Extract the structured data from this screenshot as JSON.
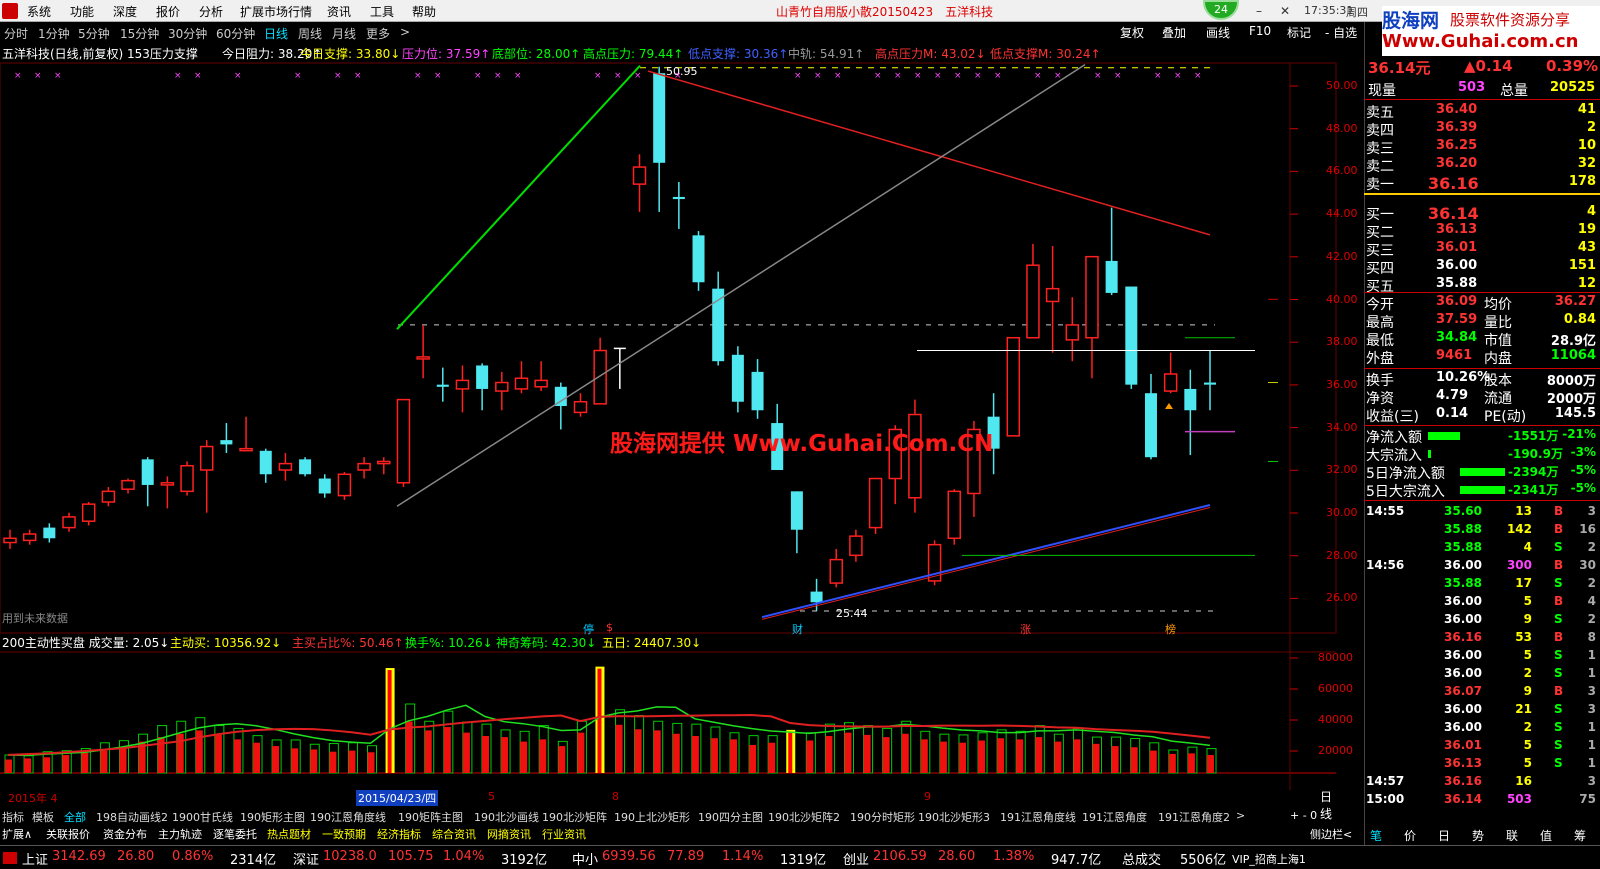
{
  "menu": {
    "items": [
      "系统",
      "功能",
      "深度",
      "报价",
      "分析",
      "扩展市场行情",
      "资讯",
      "工具",
      "帮助"
    ],
    "window_title": "山青竹自用版小散20150423　五洋科技",
    "badge": "24",
    "time": "17:35:31",
    "weekday": "周四"
  },
  "ad": {
    "line1": "股海网",
    "line2": "股票软件资源分享",
    "line3": "Www.Guhai.com.cn"
  },
  "periods": [
    "分时",
    "1分钟",
    "5分钟",
    "15分钟",
    "30分钟",
    "60分钟",
    "日线",
    "周线",
    "月线",
    "更多",
    ">"
  ],
  "active_period": "日线",
  "right_tools": [
    "复权",
    "叠加",
    "画线",
    "F10",
    "标记",
    "- 自选"
  ],
  "indicator_line": [
    {
      "text": "五洋科技(日线,前复权) 153压力支撑",
      "color": "#ffffff"
    },
    {
      "text": "今日阻力: 38.20↑",
      "color": "#ffffff"
    },
    {
      "text": "今日支撑: 33.80↓",
      "color": "#ffff00"
    },
    {
      "text": "压力位: 37.59↑",
      "color": "#ff44ff"
    },
    {
      "text": "底部位: 28.00↑",
      "color": "#00ff00"
    },
    {
      "text": "高点压力: 79.44↑",
      "color": "#00ff00"
    },
    {
      "text": "低点支撑: 30.36↑",
      "color": "#4060ff"
    },
    {
      "text": "中轨: 54.91↑",
      "color": "#999999"
    },
    {
      "text": "高点压力M: 43.02↓",
      "color": "#ff3333"
    },
    {
      "text": "低点支撑M: 30.24↑",
      "color": "#ff3333"
    }
  ],
  "price_axis": [
    "50.00",
    "48.00",
    "46.00",
    "44.00",
    "42.00",
    "40.00",
    "38.00",
    "36.00",
    "34.00",
    "32.00",
    "30.00",
    "28.00",
    "26.00"
  ],
  "volume_axis": [
    "80000",
    "60000",
    "40000",
    "20000"
  ],
  "annotations": {
    "high_label": "50.95",
    "low_label": "25.44",
    "future_note": "用到未来数据",
    "watermark": "股海网提供 Www.Guhai.Com.CN"
  },
  "markers": [
    {
      "text": "停",
      "color": "#00ccff"
    },
    {
      "text": "$",
      "color": "#ff3333"
    },
    {
      "text": "财",
      "color": "#00ccff"
    },
    {
      "text": "涨",
      "color": "#ff3333"
    },
    {
      "text": "榜",
      "color": "#ff9900"
    }
  ],
  "volume_line": [
    {
      "text": "200主动性买盘 成交量: 2.05↓",
      "color": "#ffffff"
    },
    {
      "text": "主动买: 10356.92↓",
      "color": "#ffff00"
    },
    {
      "text": "主买占比%: 50.46↑",
      "color": "#ff3333"
    },
    {
      "text": "换手%: 10.26↓",
      "color": "#00ff00"
    },
    {
      "text": "神奇筹码: 42.30↓",
      "color": "#00ff00"
    },
    {
      "text": "五日: 24407.30↓",
      "color": "#ffff00"
    }
  ],
  "date_axis": {
    "year": "2015年 4",
    "selected": "2015/04/23/四",
    "labels": [
      "5",
      "8",
      "9"
    ],
    "right": "日线"
  },
  "indicator_tabs": [
    "指标",
    "模板",
    "全部",
    "198自动画线2",
    "1900甘氏线",
    "190矩形主图",
    "190江恩角度线",
    "190矩阵主图",
    "190北沙画线",
    "190北沙矩阵",
    "190上北沙矩形",
    "190四分主图",
    "190北沙矩阵2",
    "190分时矩形",
    "190北沙矩形3",
    "191江恩角度线",
    "191江恩角度",
    "191江恩角度2",
    ">"
  ],
  "zoom_controls": "+ - 0",
  "links": [
    {
      "text": "扩展∧",
      "color": "#ffffff"
    },
    {
      "text": "关联报价",
      "color": "#ffffff"
    },
    {
      "text": "资金分布",
      "color": "#ffffff"
    },
    {
      "text": "主力轨迹",
      "color": "#ffffff"
    },
    {
      "text": "逐笔委托",
      "color": "#ffffff"
    },
    {
      "text": "热点题材",
      "color": "#ffff00"
    },
    {
      "text": "一致预期",
      "color": "#ffff00"
    },
    {
      "text": "经济指标",
      "color": "#ffff00"
    },
    {
      "text": "综合资讯",
      "color": "#ffff00"
    },
    {
      "text": "网摘资讯",
      "color": "#ffff00"
    },
    {
      "text": "行业资讯",
      "color": "#ffff00"
    }
  ],
  "side_toggle": "侧边栏<",
  "status": [
    {
      "name": "上证",
      "price": "3142.69",
      "change": "26.80",
      "pct": "0.86%",
      "amount": "2314亿"
    },
    {
      "name": "深证",
      "price": "10238.0",
      "change": "105.75",
      "pct": "1.04%",
      "amount": "3192亿"
    },
    {
      "name": "中小",
      "price": "6939.56",
      "change": "77.89",
      "pct": "1.14%",
      "amount": "1319亿"
    },
    {
      "name": "创业",
      "price": "2106.59",
      "change": "28.60",
      "pct": "1.38%",
      "amount": "947.7亿"
    }
  ],
  "status_total": {
    "label": "总成交",
    "value": "5506亿",
    "broker": "VIP_招商上海1"
  },
  "quote": {
    "price": "36.14元",
    "change": "▲0.14",
    "pct": "0.39%",
    "now_label": "现量",
    "now": "503",
    "total_label": "总量",
    "total": "20525",
    "asks": [
      {
        "label": "卖五",
        "price": "36.40",
        "vol": "41"
      },
      {
        "label": "卖四",
        "price": "36.39",
        "vol": "2"
      },
      {
        "label": "卖三",
        "price": "36.25",
        "vol": "10"
      },
      {
        "label": "卖二",
        "price": "36.20",
        "vol": "32"
      },
      {
        "label": "卖一",
        "price": "36.16",
        "vol": "178"
      }
    ],
    "bids": [
      {
        "label": "买一",
        "price": "36.14",
        "vol": "4"
      },
      {
        "label": "买二",
        "price": "36.13",
        "vol": "19"
      },
      {
        "label": "买三",
        "price": "36.01",
        "vol": "43"
      },
      {
        "label": "买四",
        "price": "36.00",
        "vol": "151"
      },
      {
        "label": "买五",
        "price": "35.88",
        "vol": "12"
      }
    ],
    "stats": [
      {
        "l1": "今开",
        "v1": "36.09",
        "c1": "#ff3333",
        "l2": "均价",
        "v2": "36.27",
        "c2": "#ff3333"
      },
      {
        "l1": "最高",
        "v1": "37.59",
        "c1": "#ff3333",
        "l2": "量比",
        "v2": "0.84",
        "c2": "#ffff00"
      },
      {
        "l1": "最低",
        "v1": "34.84",
        "c1": "#00ff00",
        "l2": "市值",
        "v2": "28.9亿",
        "c2": "#ffffff"
      },
      {
        "l1": "外盘",
        "v1": "9461",
        "c1": "#ff3333",
        "l2": "内盘",
        "v2": "11064",
        "c2": "#00ff00"
      }
    ],
    "stats2": [
      {
        "l1": "换手",
        "v1": "10.26%",
        "l2": "股本",
        "v2": "8000万"
      },
      {
        "l1": "净资",
        "v1": "4.79",
        "l2": "流通",
        "v2": "2000万"
      },
      {
        "l1": "收益(三)",
        "v1": "0.14",
        "l2": "PE(动)",
        "v2": "145.5"
      }
    ],
    "flows": [
      {
        "label": "净流入额",
        "value": "-1551万",
        "pct": "-21%",
        "bar": 0.63
      },
      {
        "label": "大宗流入",
        "value": "-190.9万",
        "pct": "-3%",
        "bar": 0.06
      },
      {
        "label": "5日净流入额",
        "value": "-2394万",
        "pct": "-5%",
        "bar": 0.9
      },
      {
        "label": "5日大宗流入",
        "value": "-2341万",
        "pct": "-5%",
        "bar": 0.9
      }
    ]
  },
  "ticks": [
    {
      "time": "14:55",
      "price": "35.60",
      "vol": "13",
      "bs": "B",
      "n": "3"
    },
    {
      "time": "",
      "price": "35.88",
      "vol": "142",
      "bs": "B",
      "n": "16"
    },
    {
      "time": "",
      "price": "35.88",
      "vol": "4",
      "bs": "S",
      "n": "2"
    },
    {
      "time": "14:56",
      "price": "36.00",
      "vol": "300",
      "bs": "B",
      "n": "30"
    },
    {
      "time": "",
      "price": "35.88",
      "vol": "17",
      "bs": "S",
      "n": "2"
    },
    {
      "time": "",
      "price": "36.00",
      "vol": "5",
      "bs": "B",
      "n": "4"
    },
    {
      "time": "",
      "price": "36.00",
      "vol": "9",
      "bs": "S",
      "n": "2"
    },
    {
      "time": "",
      "price": "36.16",
      "vol": "53",
      "bs": "B",
      "n": "8"
    },
    {
      "time": "",
      "price": "36.00",
      "vol": "5",
      "bs": "S",
      "n": "1"
    },
    {
      "time": "",
      "price": "36.00",
      "vol": "2",
      "bs": "S",
      "n": "1"
    },
    {
      "time": "",
      "price": "36.07",
      "vol": "9",
      "bs": "B",
      "n": "3"
    },
    {
      "time": "",
      "price": "36.00",
      "vol": "21",
      "bs": "S",
      "n": "3"
    },
    {
      "time": "",
      "price": "36.00",
      "vol": "2",
      "bs": "S",
      "n": "1"
    },
    {
      "time": "",
      "price": "36.01",
      "vol": "5",
      "bs": "S",
      "n": "1"
    },
    {
      "time": "",
      "price": "36.13",
      "vol": "5",
      "bs": "S",
      "n": "1"
    },
    {
      "time": "14:57",
      "price": "36.16",
      "vol": "16",
      "bs": "",
      "n": "3"
    },
    {
      "time": "15:00",
      "price": "36.14",
      "vol": "503",
      "bs": "",
      "n": "75"
    }
  ],
  "side_tabs": [
    "笔",
    "价",
    "日",
    "势",
    "联",
    "值",
    "筹"
  ],
  "chart_data": {
    "type": "candlestick",
    "ylim": [
      25,
      51
    ],
    "candles": [
      [
        28.6,
        28.8,
        29.2,
        28.3
      ],
      [
        28.7,
        29.0,
        29.2,
        28.5
      ],
      [
        29.3,
        28.8,
        29.5,
        28.6
      ],
      [
        29.3,
        29.8,
        30.0,
        29.1
      ],
      [
        29.6,
        30.4,
        30.5,
        29.4
      ],
      [
        30.5,
        31.0,
        31.2,
        30.3
      ],
      [
        31.1,
        31.5,
        31.6,
        30.9
      ],
      [
        32.5,
        31.3,
        32.6,
        30.3
      ],
      [
        31.3,
        31.4,
        31.7,
        30.2
      ],
      [
        31.0,
        32.2,
        32.4,
        30.8
      ],
      [
        32.0,
        33.1,
        33.4,
        30.0
      ],
      [
        33.4,
        33.2,
        34.2,
        32.8
      ],
      [
        33.0,
        33.0,
        34.5,
        33.0
      ],
      [
        32.9,
        31.8,
        33.0,
        31.4
      ],
      [
        32.0,
        32.3,
        32.8,
        31.5
      ],
      [
        32.5,
        31.8,
        32.6,
        31.7
      ],
      [
        31.6,
        30.9,
        31.8,
        30.7
      ],
      [
        30.8,
        31.8,
        31.9,
        30.6
      ],
      [
        32.0,
        32.3,
        32.6,
        31.6
      ],
      [
        32.3,
        32.4,
        32.6,
        31.8
      ],
      [
        31.4,
        35.3,
        35.3,
        31.2
      ],
      [
        37.3,
        37.3,
        38.8,
        36.3
      ],
      [
        36.0,
        35.9,
        36.8,
        35.2
      ],
      [
        35.8,
        36.2,
        36.9,
        34.7
      ],
      [
        36.9,
        35.8,
        37.0,
        34.8
      ],
      [
        35.7,
        36.1,
        36.6,
        34.8
      ],
      [
        35.8,
        36.3,
        37.1,
        35.6
      ],
      [
        35.9,
        36.2,
        37.1,
        35.7
      ],
      [
        35.9,
        35.0,
        36.1,
        33.9
      ],
      [
        34.7,
        35.2,
        35.6,
        34.5
      ],
      [
        35.1,
        37.6,
        38.2,
        35.1
      ],
      [
        null,
        null,
        37.7,
        35.8
      ],
      [
        45.4,
        46.2,
        46.8,
        44.1
      ],
      [
        50.6,
        46.4,
        50.9,
        44.1
      ],
      [
        44.8,
        44.7,
        45.5,
        43.3
      ],
      [
        43.0,
        40.8,
        43.2,
        40.4
      ],
      [
        40.5,
        37.1,
        41.3,
        36.9
      ],
      [
        37.4,
        35.2,
        37.8,
        34.7
      ],
      [
        36.6,
        34.8,
        37.2,
        34.4
      ],
      [
        34.2,
        32.0,
        35.1,
        32.0
      ],
      [
        31.0,
        29.2,
        31.0,
        28.1
      ],
      [
        26.3,
        25.8,
        26.9,
        25.4
      ],
      [
        26.7,
        27.8,
        28.3,
        26.5
      ],
      [
        28.0,
        28.9,
        29.2,
        27.7
      ],
      [
        29.3,
        31.6,
        31.6,
        29.0
      ],
      [
        31.6,
        33.9,
        34.1,
        30.4
      ],
      [
        30.7,
        34.6,
        35.3,
        30.0
      ],
      [
        26.8,
        28.5,
        28.7,
        26.6
      ],
      [
        28.8,
        31.0,
        31.1,
        28.5
      ],
      [
        30.9,
        33.9,
        34.3,
        29.8
      ],
      [
        34.5,
        33.0,
        35.6,
        31.8
      ],
      [
        33.6,
        38.2,
        38.2,
        33.6
      ],
      [
        38.2,
        41.6,
        42.6,
        38.2
      ],
      [
        39.9,
        40.5,
        42.5,
        37.5
      ],
      [
        38.1,
        38.8,
        40.1,
        37.1
      ],
      [
        38.2,
        42.0,
        42.0,
        36.3
      ],
      [
        41.8,
        40.3,
        44.3,
        40.2
      ],
      [
        40.6,
        36.0,
        40.6,
        35.8
      ],
      [
        35.6,
        32.6,
        36.5,
        32.5
      ],
      [
        35.7,
        36.5,
        37.5,
        35.6
      ],
      [
        35.8,
        34.8,
        36.7,
        32.7
      ],
      [
        36.1,
        36.0,
        37.6,
        34.8
      ]
    ],
    "volumes": [
      [
        12000,
        12500,
        "g"
      ],
      [
        13000,
        12000,
        "r"
      ],
      [
        14000,
        14800,
        "g"
      ],
      [
        16000,
        15500,
        "g"
      ],
      [
        18000,
        17000,
        "r"
      ],
      [
        20000,
        21000,
        "g"
      ],
      [
        22000,
        22500,
        "r"
      ],
      [
        28000,
        27000,
        "g"
      ],
      [
        32000,
        33000,
        "g"
      ],
      [
        35000,
        36000,
        "r"
      ],
      [
        38000,
        38500,
        "g"
      ],
      [
        34000,
        33000,
        "r"
      ],
      [
        30000,
        31000,
        "g"
      ],
      [
        27000,
        26000,
        "g"
      ],
      [
        24000,
        23000,
        "r"
      ],
      [
        22000,
        23000,
        "g"
      ],
      [
        21000,
        20000,
        "g"
      ],
      [
        19000,
        20500,
        "g"
      ],
      [
        20000,
        21000,
        "r"
      ],
      [
        18500,
        19000,
        "g"
      ],
      [
        73000,
        73000,
        "y"
      ],
      [
        46000,
        48000,
        "g"
      ],
      [
        38000,
        36000,
        "r"
      ],
      [
        41000,
        43000,
        "g"
      ],
      [
        36000,
        35500,
        "g"
      ],
      [
        33000,
        34000,
        "r"
      ],
      [
        32000,
        30000,
        "g"
      ],
      [
        28000,
        29000,
        "r"
      ],
      [
        30000,
        33000,
        "g"
      ],
      [
        24000,
        22000,
        "r"
      ],
      [
        36000,
        36000,
        "r"
      ],
      [
        74000,
        74000,
        "y"
      ],
      [
        43000,
        44000,
        "g"
      ],
      [
        39000,
        40000,
        "g"
      ],
      [
        38000,
        36000,
        "r"
      ],
      [
        35000,
        34500,
        "g"
      ],
      [
        33000,
        34000,
        "g"
      ],
      [
        31000,
        32000,
        "r"
      ],
      [
        30000,
        28000,
        "g"
      ],
      [
        25000,
        26000,
        "g"
      ],
      [
        27000,
        26000,
        "g"
      ],
      [
        30000,
        30000,
        "y"
      ],
      [
        29000,
        28000,
        "r"
      ],
      [
        33000,
        34000,
        "g"
      ],
      [
        36000,
        35000,
        "r"
      ],
      [
        34000,
        33000,
        "r"
      ],
      [
        32000,
        31000,
        "g"
      ],
      [
        35000,
        36000,
        "g"
      ],
      [
        30000,
        29000,
        "r"
      ],
      [
        28000,
        27000,
        "r"
      ],
      [
        27000,
        26500,
        "g"
      ],
      [
        29000,
        28000,
        "r"
      ],
      [
        31000,
        30000,
        "r"
      ],
      [
        30000,
        29000,
        "g"
      ],
      [
        32000,
        33000,
        "g"
      ],
      [
        28000,
        27000,
        "r"
      ],
      [
        30000,
        31000,
        "g"
      ],
      [
        26000,
        25000,
        "r"
      ],
      [
        24000,
        25000,
        "g"
      ],
      [
        23000,
        24000,
        "g"
      ],
      [
        20000,
        21000,
        "r"
      ],
      [
        17000,
        16000,
        "g"
      ],
      [
        17500,
        18000,
        "g"
      ],
      [
        16000,
        17000,
        "r"
      ]
    ]
  }
}
